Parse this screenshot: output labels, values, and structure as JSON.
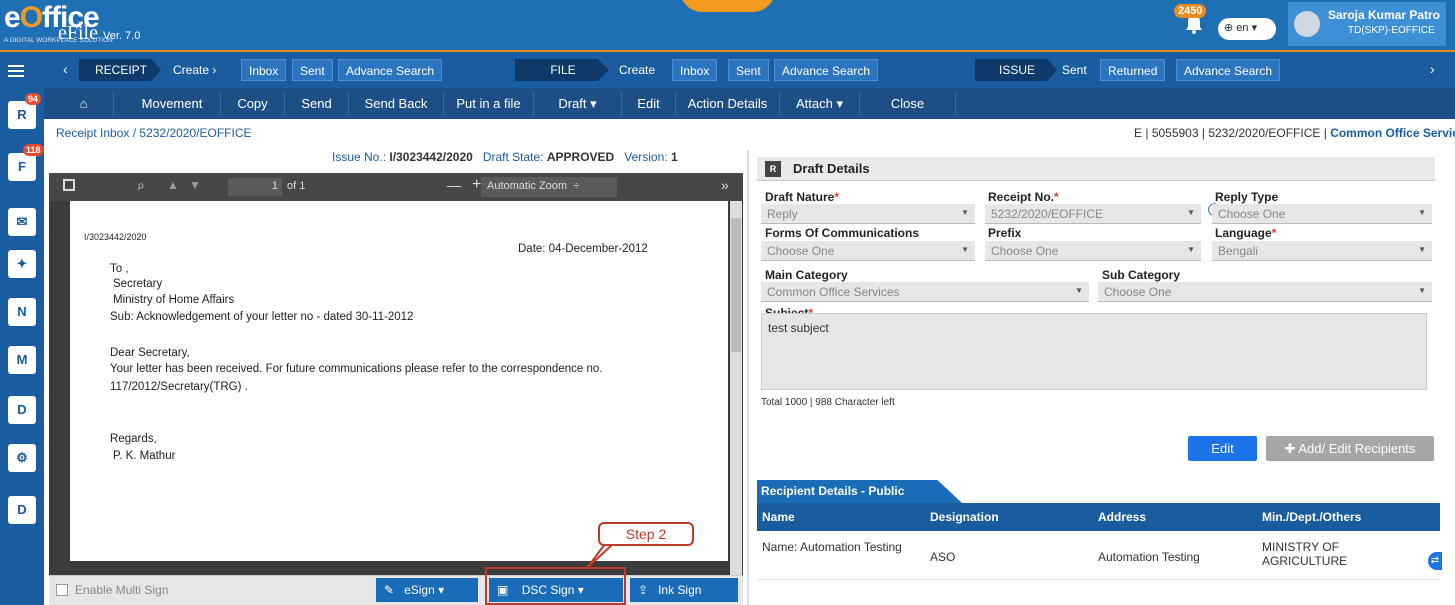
{
  "header": {
    "logo": "eOffice",
    "logo_tagline": "A DIGITAL WORKPLACE SOLUTION",
    "app_name": "eFile",
    "version": "Ver. 7.0",
    "notif_count": "2450",
    "language": "en",
    "user_name": "Saroja Kumar Patro",
    "user_role": "TD(SKP)-EOFFICE"
  },
  "menu": {
    "receipt": {
      "head": "RECEIPT",
      "items": [
        "Create ›",
        "Inbox",
        "Sent",
        "Advance Search"
      ]
    },
    "file": {
      "head": "FILE",
      "items": [
        "Create",
        "Inbox",
        "Sent",
        "Advance Search"
      ]
    },
    "issue": {
      "head": "ISSUE",
      "items": [
        "Sent",
        "Returned",
        "Advance Search"
      ]
    }
  },
  "actions": [
    "Movement",
    "Copy",
    "Send",
    "Send Back",
    "Put in a file",
    "Draft ▾",
    "Edit",
    "Action Details",
    "Attach ▾",
    "Close"
  ],
  "rail": {
    "badge_receipt": "94",
    "badge_file": "118"
  },
  "breadcrumb": {
    "root": "Receipt Inbox",
    "sep": "/",
    "current": "5232/2020/EOFFICE"
  },
  "right_info": {
    "prefix": "E",
    "id": "5055903",
    "file_no": "5232/2020/EOFFICE",
    "category": "Common Office Services"
  },
  "doc": {
    "issue_label": "Issue No.:",
    "issue_no": "I/3023442/2020",
    "state_label": "Draft State:",
    "state": "APPROVED",
    "version_label": "Version:",
    "version": "1",
    "page_no": "1",
    "page_of": "of 1",
    "zoom": "Automatic Zoom",
    "ref": "I/3023442/2020",
    "date": "Date: 04-December-2012",
    "to": "To ,",
    "l1": "Secretary",
    "l2": "Ministry of Home Affairs",
    "sub": "Sub: Acknowledgement of your letter no - dated 30-11-2012",
    "dear": "Dear Secretary,",
    "body1": "Your letter has been received. For future communications please refer to the correspondence no.",
    "body2": "117/2012/Secretary(TRG) .",
    "regards": "Regards,",
    "sign": "P. K. Mathur"
  },
  "sign": {
    "multi": "Enable Multi Sign",
    "esign": "eSign",
    "dsc": "DSC Sign",
    "ink": "Ink Sign",
    "step": "Step 2"
  },
  "draft": {
    "title": "Draft Details",
    "nature_label": "Draft Nature",
    "nature": "Reply",
    "receipt_label": "Receipt No.",
    "receipt": "5232/2020/EOFFICE",
    "reply_label": "Reply Type",
    "reply": "Choose One",
    "comm_label": "Forms Of Communications",
    "comm": "Choose One",
    "prefix_label": "Prefix",
    "prefix": "Choose One",
    "lang_label": "Language",
    "lang": "Bengali",
    "main_label": "Main Category",
    "main": "Common Office Services",
    "subcat_label": "Sub Category",
    "subcat": "Choose One",
    "subject_label": "Subject",
    "subject": "test subject",
    "chars": "Total 1000 | 988 Character left",
    "edit": "Edit",
    "add": "Add/ Edit Recipients"
  },
  "recipients": {
    "tab": "Recipient Details - Public",
    "cols": [
      "Name",
      "Designation",
      "Address",
      "Min./Dept./Others"
    ],
    "rows": [
      {
        "name": "Name: Automation Testing",
        "designation": "ASO",
        "address": "Automation Testing",
        "dept": "MINISTRY OF AGRICULTURE"
      }
    ]
  }
}
